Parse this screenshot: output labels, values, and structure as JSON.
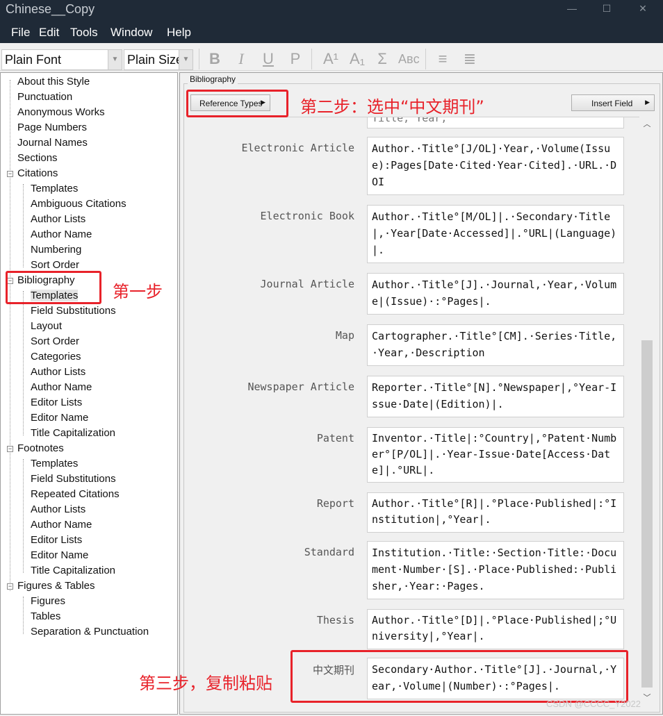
{
  "window": {
    "title": "Chinese__Copy"
  },
  "menu": [
    "File",
    "Edit",
    "Tools",
    "Window",
    "Help"
  ],
  "toolbar": {
    "font": "Plain Font",
    "size": "Plain Size",
    "buttons": [
      "B",
      "I",
      "U",
      "P",
      "A¹",
      "A₁",
      "Σ",
      "Aʙc",
      "≡",
      "≣"
    ]
  },
  "tree": {
    "style": [
      "About this Style",
      "Punctuation",
      "Anonymous Works",
      "Page Numbers",
      "Journal Names",
      "Sections"
    ],
    "citations": {
      "label": "Citations",
      "children": [
        "Templates",
        "Ambiguous Citations",
        "Author Lists",
        "Author Name",
        "Numbering",
        "Sort Order"
      ]
    },
    "bibliography": {
      "label": "Bibliography",
      "children": [
        "Templates",
        "Field Substitutions",
        "Layout",
        "Sort Order",
        "Categories",
        "Author Lists",
        "Author Name",
        "Editor Lists",
        "Editor Name",
        "Title Capitalization"
      ]
    },
    "footnotes": {
      "label": "Footnotes",
      "children": [
        "Templates",
        "Field Substitutions",
        "Repeated Citations",
        "Author Lists",
        "Author Name",
        "Editor Lists",
        "Editor Name",
        "Title Capitalization"
      ]
    },
    "figures": {
      "label": "Figures & Tables",
      "children": [
        "Figures",
        "Tables",
        "Separation & Punctuation"
      ]
    }
  },
  "annotations": {
    "step1": "第一步",
    "step2": "第二步：选中“中文期刊”",
    "step3": "第三步，复制粘贴"
  },
  "bibliography_panel": {
    "group_label": "Bibliography",
    "reference_types_button": "Reference Types",
    "insert_field_button": "Insert Field",
    "partial_top": "Title, Year,",
    "templates": [
      {
        "type": "Electronic Article",
        "template": "Author.·Title°[J/OL]·Year,·Volume(Issue):Pages[Date·Cited·Year·Cited].·URL.·DOI"
      },
      {
        "type": "Electronic Book",
        "template": "Author.·Title°[M/OL]|.·Secondary·Title|,·Year[Date·Accessed]|.°URL|(Language)|."
      },
      {
        "type": "Journal Article",
        "template": "Author.·Title°[J].·Journal,·Year,·Volume|(Issue)·:°Pages|."
      },
      {
        "type": "Map",
        "template": "Cartographer.·Title°[CM].·Series·Title,·Year,·Description"
      },
      {
        "type": "Newspaper Article",
        "template": "Reporter.·Title°[N].°Newspaper|,°Year-Issue·Date|(Edition)|."
      },
      {
        "type": "Patent",
        "template": "Inventor.·Title|:°Country|,°Patent·Number°[P/OL]|.·Year-Issue·Date[Access·Date]|.°URL|."
      },
      {
        "type": "Report",
        "template": "Author.·Title°[R]|.°Place·Published|:°Institution|,°Year|."
      },
      {
        "type": "Standard",
        "template": "Institution.·Title:·Section·Title:·Document·Number·[S].·Place·Published:·Publisher,·Year:·Pages."
      },
      {
        "type": "Thesis",
        "template": "Author.·Title°[D]|.°Place·Published|;°University|,°Year|."
      },
      {
        "type": "中文期刊",
        "template": "Secondary·Author.·Title°[J].·Journal,·Year,·Volume|(Number)·:°Pages|."
      }
    ]
  },
  "watermark": "CSDN @CCCC_Y2022"
}
